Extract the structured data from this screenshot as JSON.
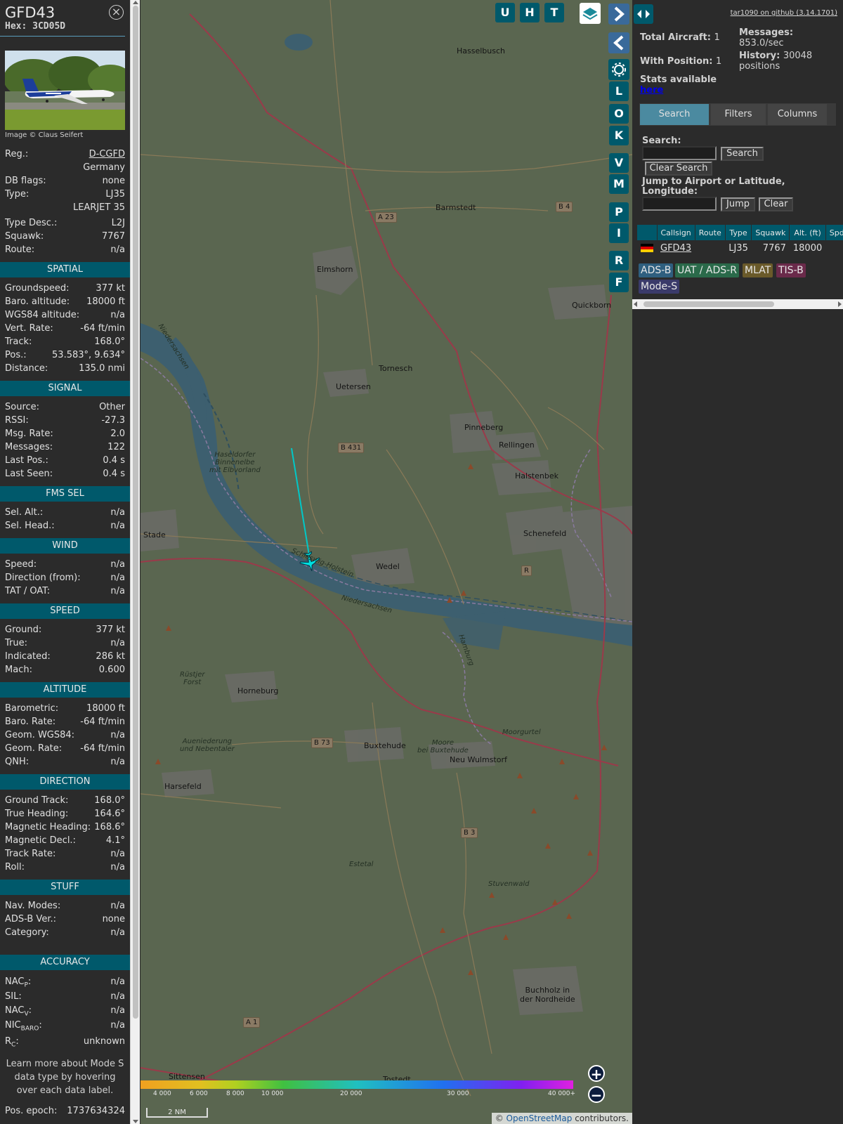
{
  "info": {
    "callsign": "GFD43",
    "hex": "Hex: 3CD05D",
    "close_icon": "×",
    "image_credit": "Image © Claus Seifert",
    "basic": {
      "reg_label": "Reg.:",
      "reg_value": "D-CGFD",
      "country": "Germany",
      "dbflags_label": "DB flags:",
      "dbflags_value": "none",
      "type_label": "Type:",
      "type_value": "LJ35",
      "type_name": "LEARJET 35",
      "typedesc_label": "Type Desc.:",
      "typedesc_value": "L2J",
      "squawk_label": "Squawk:",
      "squawk_value": "7767",
      "route_label": "Route:",
      "route_value": "n/a"
    },
    "sections": [
      {
        "title": "SPATIAL",
        "rows": [
          {
            "k": "Groundspeed:",
            "v": "377 kt"
          },
          {
            "k": "Baro. altitude:",
            "v": "18000 ft"
          },
          {
            "k": "WGS84 altitude:",
            "v": "n/a"
          },
          {
            "k": "Vert. Rate:",
            "v": "-64 ft/min"
          },
          {
            "k": "Track:",
            "v": "168.0°"
          },
          {
            "k": "Pos.:",
            "v": "53.583°, 9.634°"
          },
          {
            "k": "Distance:",
            "v": "135.0 nmi"
          }
        ]
      },
      {
        "title": "SIGNAL",
        "rows": [
          {
            "k": "Source:",
            "v": "Other"
          },
          {
            "k": "RSSI:",
            "v": "-27.3"
          },
          {
            "k": "Msg. Rate:",
            "v": "2.0"
          },
          {
            "k": "Messages:",
            "v": "122"
          },
          {
            "k": "Last Pos.:",
            "v": "0.4 s"
          },
          {
            "k": "Last Seen:",
            "v": "0.4 s"
          }
        ]
      },
      {
        "title": "FMS SEL",
        "rows": [
          {
            "k": "Sel. Alt.:",
            "v": "n/a"
          },
          {
            "k": "Sel. Head.:",
            "v": "n/a"
          }
        ]
      },
      {
        "title": "WIND",
        "rows": [
          {
            "k": "Speed:",
            "v": "n/a"
          },
          {
            "k": "Direction (from):",
            "v": "n/a"
          },
          {
            "k": "TAT / OAT:",
            "v": "n/a"
          }
        ]
      },
      {
        "title": "SPEED",
        "rows": [
          {
            "k": "Ground:",
            "v": "377 kt"
          },
          {
            "k": "True:",
            "v": "n/a"
          },
          {
            "k": "Indicated:",
            "v": "286 kt"
          },
          {
            "k": "Mach:",
            "v": "0.600"
          }
        ]
      },
      {
        "title": "ALTITUDE",
        "rows": [
          {
            "k": "Barometric:",
            "v": "18000 ft"
          },
          {
            "k": "Baro. Rate:",
            "v": "-64 ft/min"
          },
          {
            "k": "Geom. WGS84:",
            "v": "n/a"
          },
          {
            "k": "Geom. Rate:",
            "v": "-64 ft/min"
          },
          {
            "k": "QNH:",
            "v": "n/a"
          }
        ]
      },
      {
        "title": "DIRECTION",
        "rows": [
          {
            "k": "Ground Track:",
            "v": "168.0°"
          },
          {
            "k": "True Heading:",
            "v": "164.6°"
          },
          {
            "k": "Magnetic Heading:",
            "v": "168.6°"
          },
          {
            "k": "Magnetic Decl.:",
            "v": "4.1°"
          },
          {
            "k": "Track Rate:",
            "v": "n/a"
          },
          {
            "k": "Roll:",
            "v": "n/a"
          }
        ]
      },
      {
        "title": "STUFF",
        "rows": [
          {
            "k": "Nav. Modes:",
            "v": "n/a"
          },
          {
            "k": "ADS-B Ver.:",
            "v": "none"
          },
          {
            "k": "Category:",
            "v": "n/a"
          }
        ]
      }
    ],
    "accuracy": {
      "title": "ACCURACY",
      "nacp_k": "NAC",
      "nacp_sub": "P",
      "nacp_v": "n/a",
      "sil_k": "SIL:",
      "sil_v": "n/a",
      "nacv_k": "NAC",
      "nacv_sub": "V",
      "nacv_v": "n/a",
      "nic_k": "NIC",
      "nic_sub": "BARO",
      "nic_v": "n/a",
      "rc_k": "R",
      "rc_sub": "C",
      "rc_v": "unknown"
    },
    "learn_more": "Learn more about Mode S data type by hovering over each data label.",
    "epoch_label": "Pos. epoch:",
    "epoch_value": "1737634324"
  },
  "map": {
    "toolbar": {
      "u": "U",
      "h": "H",
      "t": "T"
    },
    "side_buttons": [
      "L",
      "O",
      "K",
      "V",
      "M",
      "P",
      "I",
      "R",
      "F"
    ],
    "places": {
      "hasselbusch": "Hasselbusch",
      "barmstedt": "Barmstedt",
      "elmshorn": "Elmshorn",
      "quickborn": "Quickborn",
      "tornesch": "Tornesch",
      "uetersen": "Uetersen",
      "pinneberg": "Pinneberg",
      "rellingen": "Rellingen",
      "halstenbek": "Halstenbek",
      "schenefeld": "Schenefeld",
      "stade": "Stade",
      "wedel": "Wedel",
      "horneburg": "Horneburg",
      "buxtehude": "Buxtehude",
      "neuwulmstorf": "Neu Wulmstorf",
      "harsefeld": "Harsefeld",
      "buchholz": "Buchholz in\nder Nordheide",
      "sittensen": "Sittensen",
      "tostedt": "Tostedt",
      "haseldorfer": "Haseldorfer\nBinnenelbe\nmit Elbvorland",
      "niedersachsen1": "Niedersachsen",
      "niedersachsen2": "Niedersachsen",
      "schleswig": "Schleswig-Holstein",
      "rustjer": "Rüstjer\nForst",
      "auenieder": "Aueniederung\nund Nebentaler",
      "moore": "Moore\nbei Buxtehude",
      "moorgurtel": "Moorgurtel",
      "estetal": "Estetal",
      "stuvenwald": "Stuvenwald",
      "hamburg": "Hamburg"
    },
    "roads": [
      "A 23",
      "B 4",
      "B 431",
      "B 73",
      "B 3",
      "A 1",
      "R"
    ],
    "colorbar_ticks": [
      "4 000",
      "6 000",
      "8 000",
      "10 000",
      "20 000",
      "30 000",
      "40 000+"
    ],
    "scale": "2 NM",
    "attribution_prefix": "© ",
    "attribution_link": "OpenStreetMap",
    "attribution_suffix": " contributors."
  },
  "panel": {
    "github": "tar1090 on github (3.14.1701)",
    "total_label": "Total Aircraft:",
    "total_value": "1",
    "messages_label": "Messages:",
    "messages_value": "853.0/sec",
    "withpos_label": "With Position:",
    "withpos_value": "1",
    "history_label": "History:",
    "history_value": "30048 positions",
    "stats_label": "Stats available",
    "stats_link": "here",
    "tabs": [
      "Search",
      "Filters",
      "Columns"
    ],
    "search_label": "Search:",
    "search_value": "",
    "search_btn": "Search",
    "clear_search_btn": "Clear Search",
    "jump_label": "Jump to Airport or Latitude, Longitude:",
    "jump_value": "",
    "jump_btn": "Jump",
    "clear_btn": "Clear",
    "table": {
      "headers": [
        "",
        "Callsign",
        "Route",
        "Type",
        "Squawk",
        "Alt. (ft)",
        "Spd."
      ],
      "row": {
        "callsign": "GFD43",
        "route": "",
        "type": "LJ35",
        "squawk": "7767",
        "alt": "18000"
      }
    },
    "tags": [
      {
        "label": "ADS-B",
        "color": "#2f5f7f"
      },
      {
        "label": "UAT / ADS-R",
        "color": "#2a6a4a"
      },
      {
        "label": "MLAT",
        "color": "#6a5a2a"
      },
      {
        "label": "TIS-B",
        "color": "#6a2a4a"
      },
      {
        "label": "Mode-S",
        "color": "#3a3a6a"
      }
    ]
  },
  "colors": {
    "teal": "#00596b",
    "track": "#00c8c8",
    "aircraft": "#00e0e0"
  }
}
